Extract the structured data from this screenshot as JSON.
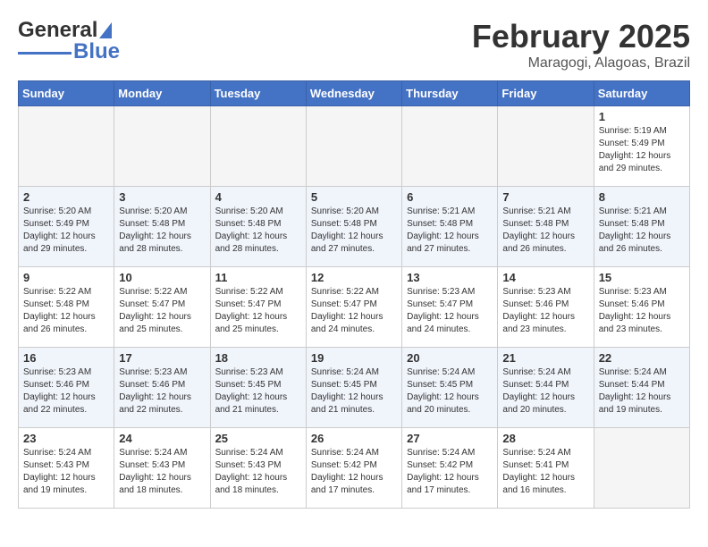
{
  "header": {
    "logo_general": "General",
    "logo_blue": "Blue",
    "month_title": "February 2025",
    "location": "Maragogi, Alagoas, Brazil"
  },
  "days_of_week": [
    "Sunday",
    "Monday",
    "Tuesday",
    "Wednesday",
    "Thursday",
    "Friday",
    "Saturday"
  ],
  "weeks": [
    [
      {
        "day": "",
        "info": ""
      },
      {
        "day": "",
        "info": ""
      },
      {
        "day": "",
        "info": ""
      },
      {
        "day": "",
        "info": ""
      },
      {
        "day": "",
        "info": ""
      },
      {
        "day": "",
        "info": ""
      },
      {
        "day": "1",
        "info": "Sunrise: 5:19 AM\nSunset: 5:49 PM\nDaylight: 12 hours\nand 29 minutes."
      }
    ],
    [
      {
        "day": "2",
        "info": "Sunrise: 5:20 AM\nSunset: 5:49 PM\nDaylight: 12 hours\nand 29 minutes."
      },
      {
        "day": "3",
        "info": "Sunrise: 5:20 AM\nSunset: 5:48 PM\nDaylight: 12 hours\nand 28 minutes."
      },
      {
        "day": "4",
        "info": "Sunrise: 5:20 AM\nSunset: 5:48 PM\nDaylight: 12 hours\nand 28 minutes."
      },
      {
        "day": "5",
        "info": "Sunrise: 5:20 AM\nSunset: 5:48 PM\nDaylight: 12 hours\nand 27 minutes."
      },
      {
        "day": "6",
        "info": "Sunrise: 5:21 AM\nSunset: 5:48 PM\nDaylight: 12 hours\nand 27 minutes."
      },
      {
        "day": "7",
        "info": "Sunrise: 5:21 AM\nSunset: 5:48 PM\nDaylight: 12 hours\nand 26 minutes."
      },
      {
        "day": "8",
        "info": "Sunrise: 5:21 AM\nSunset: 5:48 PM\nDaylight: 12 hours\nand 26 minutes."
      }
    ],
    [
      {
        "day": "9",
        "info": "Sunrise: 5:22 AM\nSunset: 5:48 PM\nDaylight: 12 hours\nand 26 minutes."
      },
      {
        "day": "10",
        "info": "Sunrise: 5:22 AM\nSunset: 5:47 PM\nDaylight: 12 hours\nand 25 minutes."
      },
      {
        "day": "11",
        "info": "Sunrise: 5:22 AM\nSunset: 5:47 PM\nDaylight: 12 hours\nand 25 minutes."
      },
      {
        "day": "12",
        "info": "Sunrise: 5:22 AM\nSunset: 5:47 PM\nDaylight: 12 hours\nand 24 minutes."
      },
      {
        "day": "13",
        "info": "Sunrise: 5:23 AM\nSunset: 5:47 PM\nDaylight: 12 hours\nand 24 minutes."
      },
      {
        "day": "14",
        "info": "Sunrise: 5:23 AM\nSunset: 5:46 PM\nDaylight: 12 hours\nand 23 minutes."
      },
      {
        "day": "15",
        "info": "Sunrise: 5:23 AM\nSunset: 5:46 PM\nDaylight: 12 hours\nand 23 minutes."
      }
    ],
    [
      {
        "day": "16",
        "info": "Sunrise: 5:23 AM\nSunset: 5:46 PM\nDaylight: 12 hours\nand 22 minutes."
      },
      {
        "day": "17",
        "info": "Sunrise: 5:23 AM\nSunset: 5:46 PM\nDaylight: 12 hours\nand 22 minutes."
      },
      {
        "day": "18",
        "info": "Sunrise: 5:23 AM\nSunset: 5:45 PM\nDaylight: 12 hours\nand 21 minutes."
      },
      {
        "day": "19",
        "info": "Sunrise: 5:24 AM\nSunset: 5:45 PM\nDaylight: 12 hours\nand 21 minutes."
      },
      {
        "day": "20",
        "info": "Sunrise: 5:24 AM\nSunset: 5:45 PM\nDaylight: 12 hours\nand 20 minutes."
      },
      {
        "day": "21",
        "info": "Sunrise: 5:24 AM\nSunset: 5:44 PM\nDaylight: 12 hours\nand 20 minutes."
      },
      {
        "day": "22",
        "info": "Sunrise: 5:24 AM\nSunset: 5:44 PM\nDaylight: 12 hours\nand 19 minutes."
      }
    ],
    [
      {
        "day": "23",
        "info": "Sunrise: 5:24 AM\nSunset: 5:43 PM\nDaylight: 12 hours\nand 19 minutes."
      },
      {
        "day": "24",
        "info": "Sunrise: 5:24 AM\nSunset: 5:43 PM\nDaylight: 12 hours\nand 18 minutes."
      },
      {
        "day": "25",
        "info": "Sunrise: 5:24 AM\nSunset: 5:43 PM\nDaylight: 12 hours\nand 18 minutes."
      },
      {
        "day": "26",
        "info": "Sunrise: 5:24 AM\nSunset: 5:42 PM\nDaylight: 12 hours\nand 17 minutes."
      },
      {
        "day": "27",
        "info": "Sunrise: 5:24 AM\nSunset: 5:42 PM\nDaylight: 12 hours\nand 17 minutes."
      },
      {
        "day": "28",
        "info": "Sunrise: 5:24 AM\nSunset: 5:41 PM\nDaylight: 12 hours\nand 16 minutes."
      },
      {
        "day": "",
        "info": ""
      }
    ]
  ]
}
